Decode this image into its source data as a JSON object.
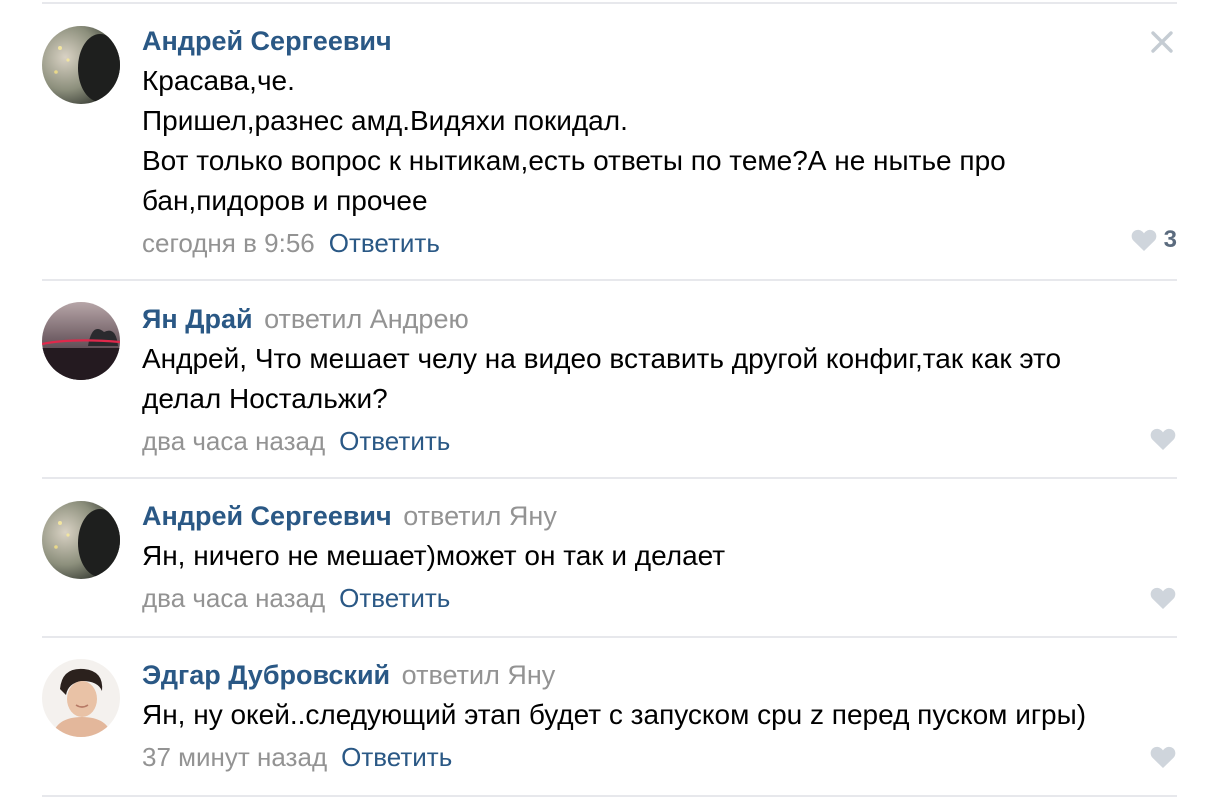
{
  "comments": [
    {
      "author": "Андрей Сергеевич",
      "replied_label": "",
      "replied_to": "",
      "text_lines": [
        "Красава,че.",
        "Пришел,разнес амд.Видяхи покидал.",
        "Вот только вопрос к нытикам,есть ответы по теме?А не нытье про",
        "бан,пидоров и прочее"
      ],
      "date": "сегодня в 9:56",
      "reply_label": "Ответить",
      "likes": "3",
      "avatar_icon": "user-photo-icon"
    },
    {
      "author": "Ян Драй",
      "replied_label": "ответил",
      "replied_to": "Андрею",
      "text_lines": [
        "Андрей, Что мешает челу на видео вставить другой конфиг,так как это",
        "делал Ностальжи?"
      ],
      "date": "два часа назад",
      "reply_label": "Ответить",
      "likes": "",
      "avatar_icon": "user-photo-icon"
    },
    {
      "author": "Андрей Сергеевич",
      "replied_label": "ответил",
      "replied_to": "Яну",
      "text_lines": [
        "Ян, ничего не мешает)может он так и делает"
      ],
      "date": "два часа назад",
      "reply_label": "Ответить",
      "likes": "",
      "avatar_icon": "user-photo-icon"
    },
    {
      "author": "Эдгар Дубровский",
      "replied_label": "ответил",
      "replied_to": "Яну",
      "text_lines": [
        "Ян, ну окей..следующий этап будет с запуском cpu z перед пуском игры)"
      ],
      "date": "37 минут назад",
      "reply_label": "Ответить",
      "likes": "",
      "avatar_icon": "user-photo-icon"
    }
  ],
  "icons": {
    "close": "close-icon",
    "like": "heart-icon"
  },
  "colors": {
    "author": "#2a5885",
    "muted": "#939393",
    "link": "#2a5885",
    "like_icon": "#cfd5dc",
    "like_count": "#5b6b7e",
    "separator": "#e7e8ec"
  }
}
